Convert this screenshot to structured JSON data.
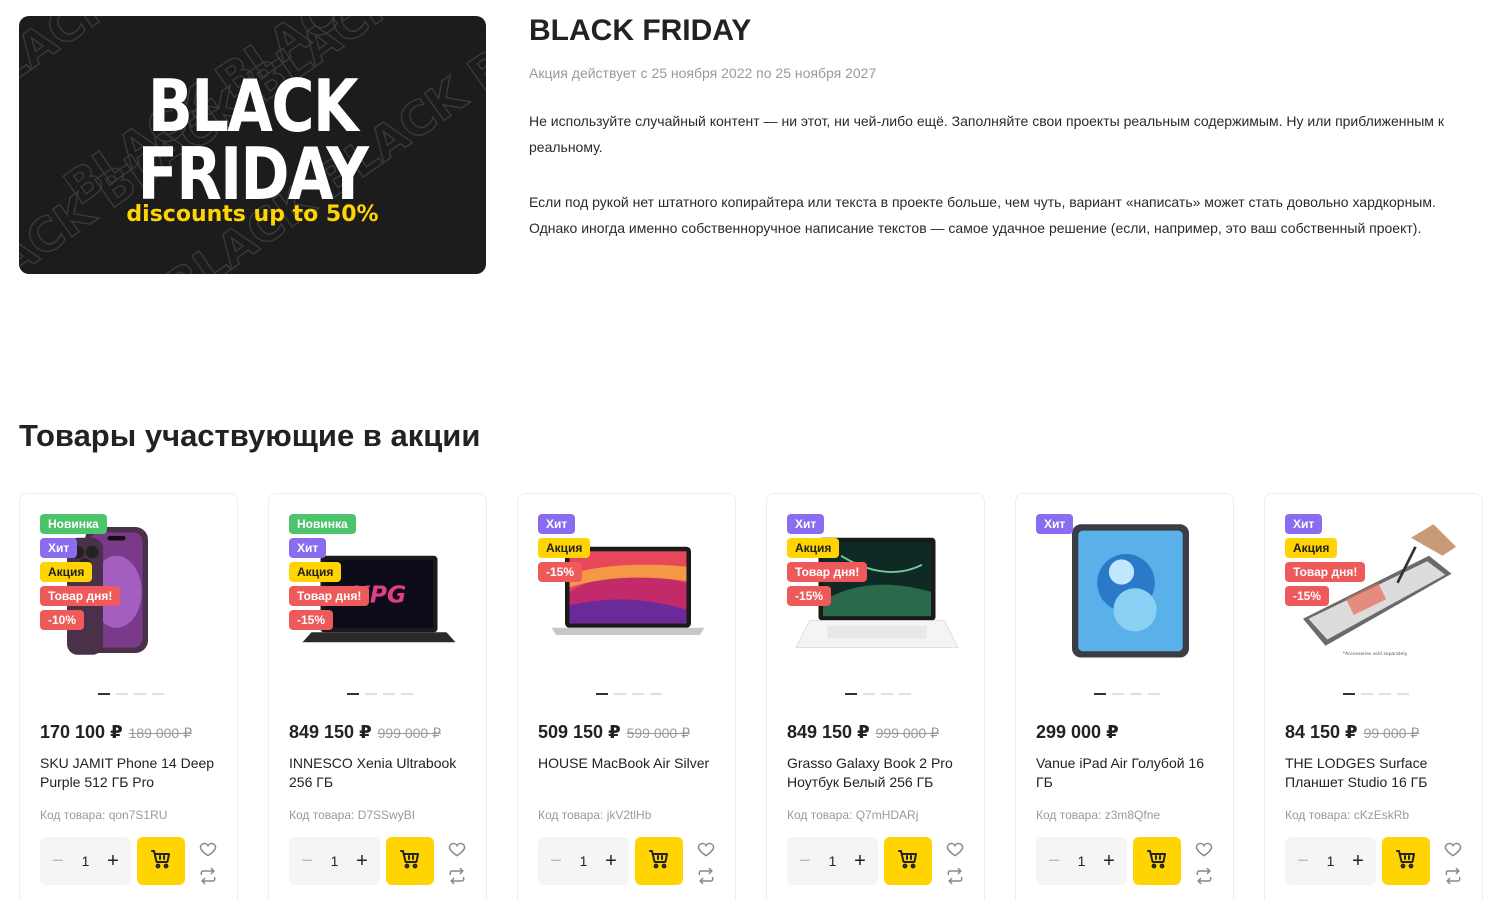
{
  "banner": {
    "line1": "BLACK",
    "line2": "FRIDAY",
    "subtitle": "discounts up to 50%",
    "watermark_text": "BLACK BLACK BLACK"
  },
  "promo": {
    "title": "BLACK FRIDAY",
    "dates": "Акция действует с 25 ноября 2022 по 25 ноября 2027",
    "paragraph1": "Не используйте случайный контент — ни этот, ни чей-либо ещё. Заполняйте свои проекты реальным содержимым. Ну или приближенным к реальному.",
    "paragraph2": "Если под рукой нет штатного копирайтера или текста в проекте больше, чем чуть, вариант «написать» может стать довольно хардкорным. Однако иногда именно собственноручное написание текстов — самое удачное решение (если, например, это ваш собственный проект)."
  },
  "section_title": "Товары участвующие в акции",
  "colors": {
    "accent": "#ffd400",
    "new": "#4cc46b",
    "hit": "#8a6cf0",
    "sale_red": "#ee5a5a"
  },
  "products": [
    {
      "image_icon": "phone-image",
      "badges": [
        "Новинка",
        "Хит",
        "Акция",
        "Товар дня!",
        "-10%"
      ],
      "price": "170 100 ₽",
      "old_price": "189 000 ₽",
      "name": "SKU JAMIT Phone 14 Deep Purple 512 ГБ Pro",
      "code": "Код товара: qon7S1RU",
      "qty": "1"
    },
    {
      "image_icon": "laptop-image",
      "badges": [
        "Новинка",
        "Хит",
        "Акция",
        "Товар дня!",
        "-15%"
      ],
      "price": "849 150 ₽",
      "old_price": "999 000 ₽",
      "name": "INNESCO Xenia Ultrabook 256 ГБ",
      "code": "Код товара: D7SSwyBI",
      "qty": "1"
    },
    {
      "image_icon": "macbook-image",
      "badges": [
        "Хит",
        "Акция",
        "-15%"
      ],
      "price": "509 150 ₽",
      "old_price": "599 000 ₽",
      "name": "HOUSE MacBook Air Silver",
      "code": "Код товара: jkV2tlHb",
      "qty": "1"
    },
    {
      "image_icon": "galaxy-book-image",
      "badges": [
        "Хит",
        "Акция",
        "Товар дня!",
        "-15%"
      ],
      "price": "849 150 ₽",
      "old_price": "999 000 ₽",
      "name": "Grasso Galaxy Book 2 Pro Ноутбук Белый 256 ГБ",
      "code": "Код товара: Q7mHDARj",
      "qty": "1"
    },
    {
      "image_icon": "ipad-image",
      "badges": [
        "Хит"
      ],
      "price": "299 000 ₽",
      "old_price": "",
      "name": "Vanue iPad Air Голубой 16 ГБ",
      "code": "Код товара: z3m8Qfne",
      "qty": "1"
    },
    {
      "image_icon": "surface-image",
      "badges": [
        "Хит",
        "Акция",
        "Товар дня!",
        "-15%"
      ],
      "price": "84 150 ₽",
      "old_price": "99 000 ₽",
      "name": "THE LODGES Surface Планшет Studio 16 ГБ",
      "code": "Код товара: cKzEskRb",
      "image_caption": "*Accessories sold separately",
      "qty": "1"
    }
  ]
}
